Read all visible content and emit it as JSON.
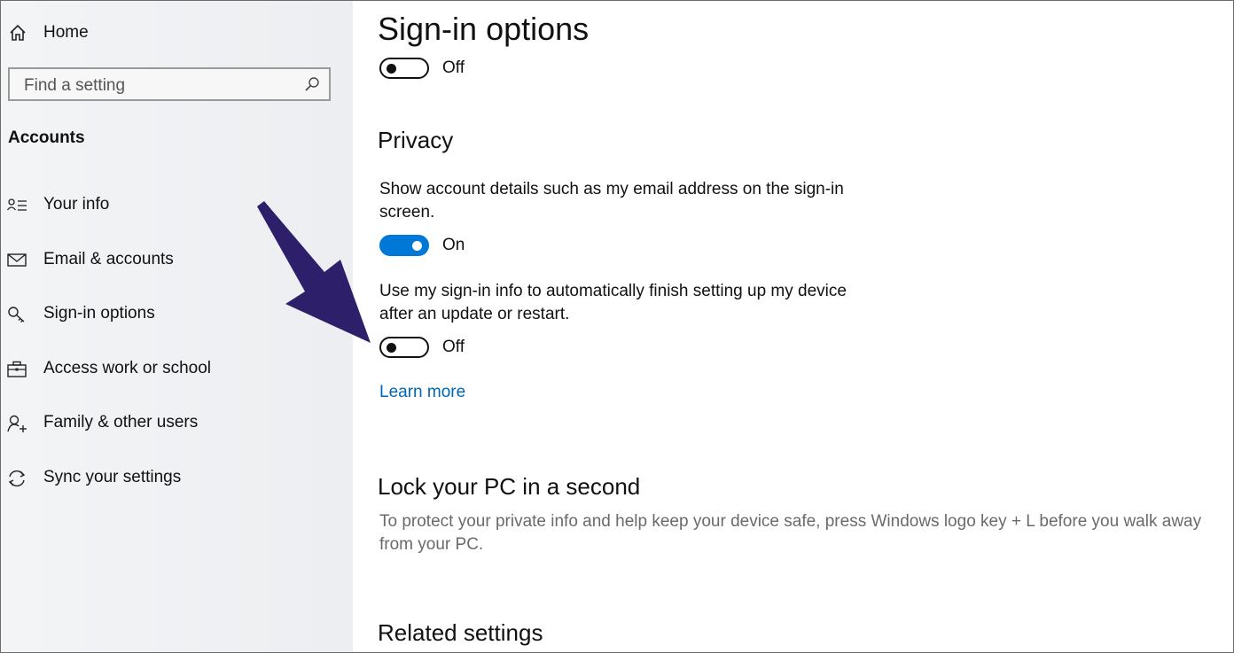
{
  "sidebar": {
    "home_label": "Home",
    "search": {
      "placeholder": "Find a setting"
    },
    "section_title": "Accounts",
    "items": [
      {
        "label": "Your info",
        "icon": "person-list-icon"
      },
      {
        "label": "Email & accounts",
        "icon": "envelope-icon"
      },
      {
        "label": "Sign-in options",
        "icon": "key-icon"
      },
      {
        "label": "Access work or school",
        "icon": "briefcase-icon"
      },
      {
        "label": "Family & other users",
        "icon": "person-add-icon"
      },
      {
        "label": "Sync your settings",
        "icon": "sync-icon"
      }
    ]
  },
  "main": {
    "page_title": "Sign-in options",
    "top_toggle": {
      "state": "Off"
    },
    "privacy": {
      "heading": "Privacy",
      "show_details": {
        "text": "Show account details such as my email address on the sign-in screen.",
        "state": "On"
      },
      "use_signin_info": {
        "text": "Use my sign-in info to automatically finish setting up my device after an update or restart.",
        "state": "Off"
      },
      "learn_more": "Learn more"
    },
    "lock": {
      "heading": "Lock your PC in a second",
      "text": "To protect your private info and help keep your device safe, press Windows logo key + L before you walk away from your PC."
    },
    "related": {
      "heading": "Related settings"
    }
  },
  "colors": {
    "accent": "#0078d7",
    "link": "#0067b8",
    "arrow": "#2e1f6b"
  }
}
